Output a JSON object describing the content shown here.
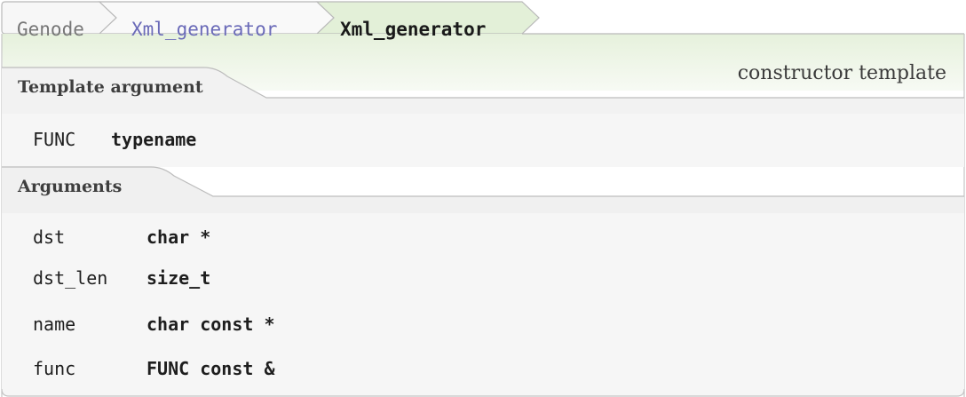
{
  "breadcrumb": [
    "Genode",
    "Xml_generator",
    "Xml_generator"
  ],
  "kind_label": "constructor template",
  "template_section": {
    "title": "Template argument",
    "args": [
      {
        "name": "FUNC",
        "type": "typename"
      }
    ]
  },
  "arguments_section": {
    "title": "Arguments",
    "args": [
      {
        "name": "dst",
        "type": "char *"
      },
      {
        "name": "dst_len",
        "type": "size_t"
      },
      {
        "name": "name",
        "type": "char const *"
      },
      {
        "name": "func",
        "type": "FUNC const &"
      }
    ]
  },
  "colors": {
    "accent_green": "#e3f0d8",
    "panel_gray": "#f5f5f5",
    "border": "#b7b7b7",
    "namespace_link": "#6a6ab8"
  }
}
